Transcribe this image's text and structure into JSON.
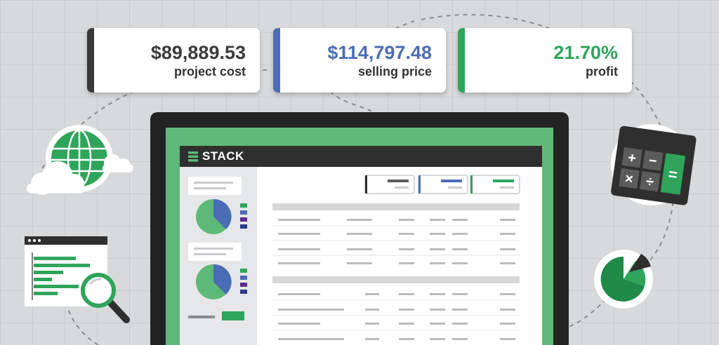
{
  "metrics": {
    "project_cost": {
      "value": "$89,889.53",
      "label": "project cost",
      "color": "#3b3b3b"
    },
    "selling_price": {
      "value": "$114,797.48",
      "label": "selling price",
      "color": "#4a6db5"
    },
    "profit": {
      "value": "21.70%",
      "label": "profit",
      "color": "#2fa45b"
    }
  },
  "app": {
    "title": "STACK"
  },
  "colors": {
    "green": "#2fa45b",
    "blue": "#4a6db5",
    "purple": "#5b2d8a",
    "navy": "#2b3a8a",
    "dark": "#2f2f2f"
  },
  "icons": [
    "globe-icon",
    "cloud-icon",
    "spreadsheet-window-icon",
    "magnifier-icon",
    "calculator-icon",
    "pie-chart-icon"
  ]
}
